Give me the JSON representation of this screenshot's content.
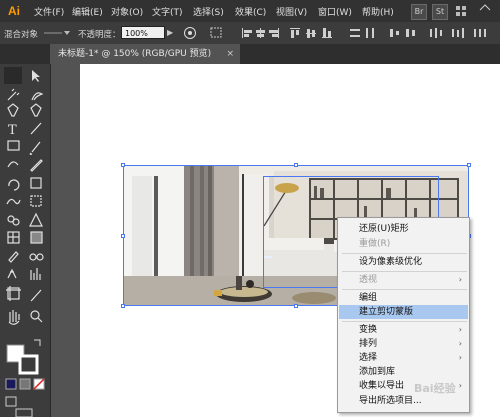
{
  "app": {
    "logo": "Ai"
  },
  "menubar": {
    "items": [
      "文件(F)",
      "编辑(E)",
      "对象(O)",
      "文字(T)",
      "选择(S)",
      "效果(C)",
      "视图(V)",
      "窗口(W)",
      "帮助(H)"
    ],
    "right_badges": [
      "Br",
      "St"
    ]
  },
  "control_bar": {
    "object_label": "混合对象",
    "opacity_label": "不透明度：",
    "opacity_value": "100%"
  },
  "document_tab": {
    "title": "未标题-1* @ 150% (RGB/GPU 预览)",
    "close": "×"
  },
  "context_menu": {
    "items": [
      {
        "label": "还原(U)矩形",
        "disabled": false
      },
      {
        "label": "重做(R)",
        "disabled": true
      },
      {
        "label": "设为像素级优化",
        "disabled": false
      },
      {
        "label": "透视",
        "disabled": true,
        "submenu": true
      },
      {
        "label": "编组",
        "disabled": false
      },
      {
        "label": "建立剪切蒙版",
        "disabled": false,
        "highlighted": true
      },
      {
        "label": "变换",
        "disabled": false,
        "submenu": true
      },
      {
        "label": "排列",
        "disabled": false,
        "submenu": true
      },
      {
        "label": "选择",
        "disabled": false,
        "submenu": true
      },
      {
        "label": "添加到库",
        "disabled": false
      },
      {
        "label": "收集以导出",
        "disabled": false
      },
      {
        "label": "导出所选项目...",
        "disabled": false
      }
    ]
  },
  "watermark": {
    "text": "Bai经验"
  },
  "colors": {
    "accent": "#ff9a00",
    "selection": "#4a78f0",
    "menu_highlight": "#a9c8f0"
  }
}
